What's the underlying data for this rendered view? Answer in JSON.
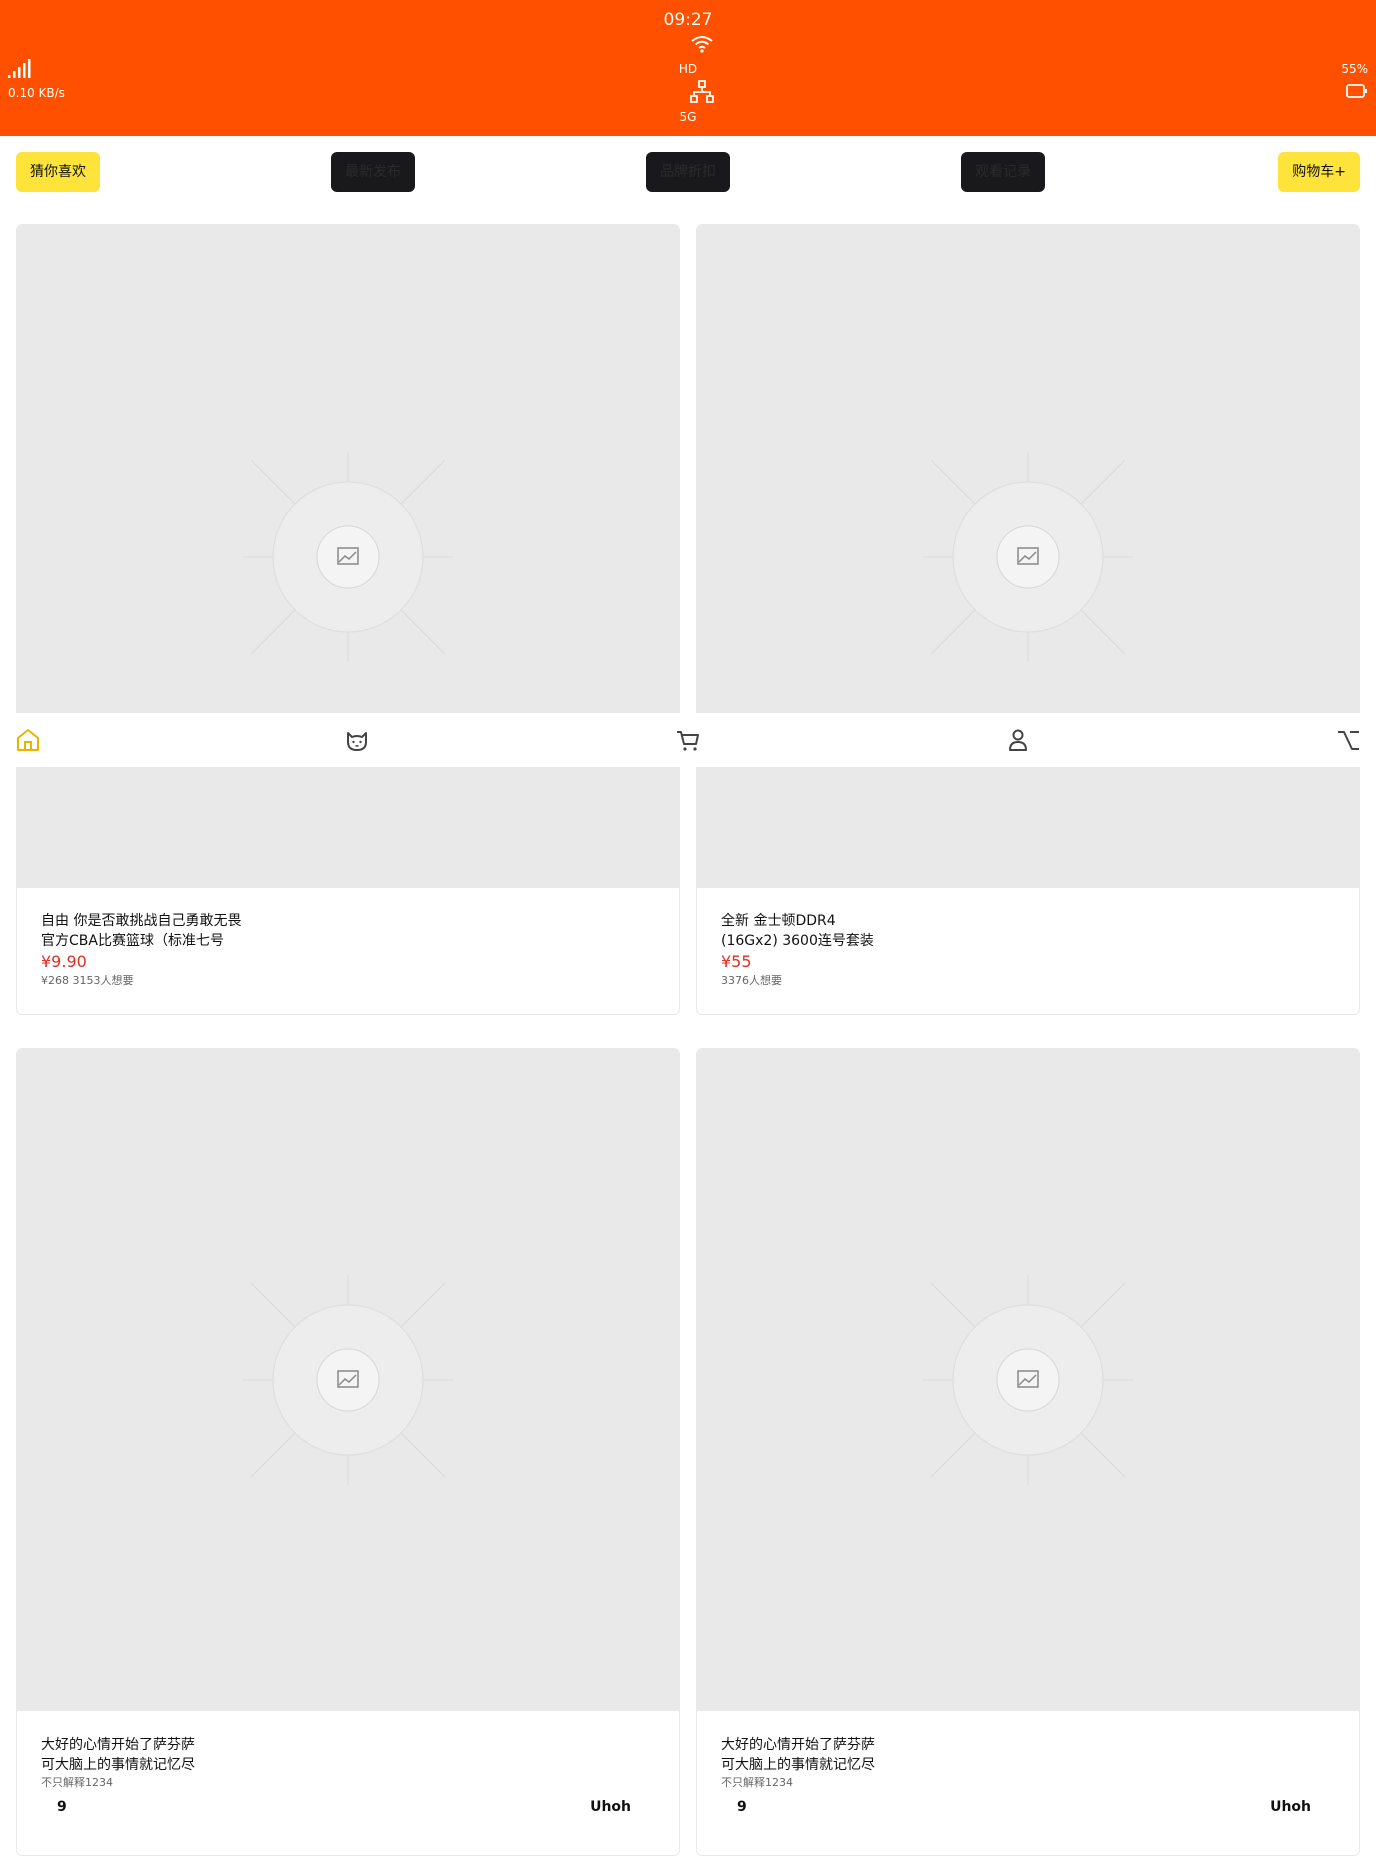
{
  "status_bar": {
    "background": "#ff5000",
    "time": "09:27",
    "hd": "HD",
    "network_type": "5G",
    "speed": "0.10 KB/s",
    "battery": "55%",
    "icons": [
      "wifi-icon",
      "network-icon",
      "signal-icon",
      "battery-icon"
    ]
  },
  "top_buttons": [
    {
      "label": "猜你喜欢",
      "style": "yellow"
    },
    {
      "label": "最新发布",
      "style": "dark"
    },
    {
      "label": "品牌折扣",
      "style": "dark"
    },
    {
      "label": "观看记录",
      "style": "dark"
    },
    {
      "label": "购物车+",
      "style": "yellow"
    }
  ],
  "products": [
    {
      "title_line1": "自由 你是否敢挑战自己勇敢无畏",
      "title_line2": "官方CBA比赛篮球（标准七号",
      "price": "¥9.90",
      "meta": "¥268 3153人想要"
    },
    {
      "title_line1": "全新 金士顿DDR4",
      "title_line2": "(16Gx2) 3600连号套装",
      "price": "¥55",
      "meta": "3376人想要"
    },
    {
      "title_line1": "大好的心情开始了萨芬萨",
      "title_line2": "可大脑上的事情就记忆尽",
      "meta": "不只解释1234",
      "count": "9",
      "tag": "Uhoh"
    },
    {
      "title_line1": "大好的心情开始了萨芬萨",
      "title_line2": "可大脑上的事情就记忆尽",
      "meta": "不只解释1234",
      "count": "9",
      "tag": "Uhoh"
    }
  ],
  "tab_bar": {
    "active_color": "#e8b400",
    "inactive_color": "#444444",
    "tabs": [
      "home-icon",
      "cat-icon",
      "cart-icon",
      "user-icon",
      "option-icon"
    ]
  }
}
